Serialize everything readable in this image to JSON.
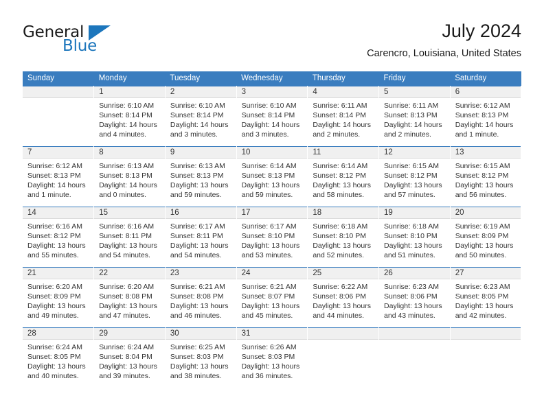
{
  "brand": {
    "name_part1": "General",
    "name_part2": "Blue",
    "accent_color": "#1c76bc"
  },
  "header": {
    "title": "July 2024",
    "subtitle": "Carencro, Louisiana, United States"
  },
  "theme": {
    "header_row_bg": "#3a7dbf",
    "daynum_band_bg": "#f0f0f0",
    "text_color": "#333333"
  },
  "weekday_headers": [
    "Sunday",
    "Monday",
    "Tuesday",
    "Wednesday",
    "Thursday",
    "Friday",
    "Saturday"
  ],
  "weeks": [
    [
      {
        "day": "",
        "sunrise": "",
        "sunset": "",
        "daylight": "",
        "empty": true
      },
      {
        "day": "1",
        "sunrise": "Sunrise: 6:10 AM",
        "sunset": "Sunset: 8:14 PM",
        "daylight": "Daylight: 14 hours and 4 minutes."
      },
      {
        "day": "2",
        "sunrise": "Sunrise: 6:10 AM",
        "sunset": "Sunset: 8:14 PM",
        "daylight": "Daylight: 14 hours and 3 minutes."
      },
      {
        "day": "3",
        "sunrise": "Sunrise: 6:10 AM",
        "sunset": "Sunset: 8:14 PM",
        "daylight": "Daylight: 14 hours and 3 minutes."
      },
      {
        "day": "4",
        "sunrise": "Sunrise: 6:11 AM",
        "sunset": "Sunset: 8:14 PM",
        "daylight": "Daylight: 14 hours and 2 minutes."
      },
      {
        "day": "5",
        "sunrise": "Sunrise: 6:11 AM",
        "sunset": "Sunset: 8:13 PM",
        "daylight": "Daylight: 14 hours and 2 minutes."
      },
      {
        "day": "6",
        "sunrise": "Sunrise: 6:12 AM",
        "sunset": "Sunset: 8:13 PM",
        "daylight": "Daylight: 14 hours and 1 minute."
      }
    ],
    [
      {
        "day": "7",
        "sunrise": "Sunrise: 6:12 AM",
        "sunset": "Sunset: 8:13 PM",
        "daylight": "Daylight: 14 hours and 1 minute."
      },
      {
        "day": "8",
        "sunrise": "Sunrise: 6:13 AM",
        "sunset": "Sunset: 8:13 PM",
        "daylight": "Daylight: 14 hours and 0 minutes."
      },
      {
        "day": "9",
        "sunrise": "Sunrise: 6:13 AM",
        "sunset": "Sunset: 8:13 PM",
        "daylight": "Daylight: 13 hours and 59 minutes."
      },
      {
        "day": "10",
        "sunrise": "Sunrise: 6:14 AM",
        "sunset": "Sunset: 8:13 PM",
        "daylight": "Daylight: 13 hours and 59 minutes."
      },
      {
        "day": "11",
        "sunrise": "Sunrise: 6:14 AM",
        "sunset": "Sunset: 8:12 PM",
        "daylight": "Daylight: 13 hours and 58 minutes."
      },
      {
        "day": "12",
        "sunrise": "Sunrise: 6:15 AM",
        "sunset": "Sunset: 8:12 PM",
        "daylight": "Daylight: 13 hours and 57 minutes."
      },
      {
        "day": "13",
        "sunrise": "Sunrise: 6:15 AM",
        "sunset": "Sunset: 8:12 PM",
        "daylight": "Daylight: 13 hours and 56 minutes."
      }
    ],
    [
      {
        "day": "14",
        "sunrise": "Sunrise: 6:16 AM",
        "sunset": "Sunset: 8:12 PM",
        "daylight": "Daylight: 13 hours and 55 minutes."
      },
      {
        "day": "15",
        "sunrise": "Sunrise: 6:16 AM",
        "sunset": "Sunset: 8:11 PM",
        "daylight": "Daylight: 13 hours and 54 minutes."
      },
      {
        "day": "16",
        "sunrise": "Sunrise: 6:17 AM",
        "sunset": "Sunset: 8:11 PM",
        "daylight": "Daylight: 13 hours and 54 minutes."
      },
      {
        "day": "17",
        "sunrise": "Sunrise: 6:17 AM",
        "sunset": "Sunset: 8:10 PM",
        "daylight": "Daylight: 13 hours and 53 minutes."
      },
      {
        "day": "18",
        "sunrise": "Sunrise: 6:18 AM",
        "sunset": "Sunset: 8:10 PM",
        "daylight": "Daylight: 13 hours and 52 minutes."
      },
      {
        "day": "19",
        "sunrise": "Sunrise: 6:18 AM",
        "sunset": "Sunset: 8:10 PM",
        "daylight": "Daylight: 13 hours and 51 minutes."
      },
      {
        "day": "20",
        "sunrise": "Sunrise: 6:19 AM",
        "sunset": "Sunset: 8:09 PM",
        "daylight": "Daylight: 13 hours and 50 minutes."
      }
    ],
    [
      {
        "day": "21",
        "sunrise": "Sunrise: 6:20 AM",
        "sunset": "Sunset: 8:09 PM",
        "daylight": "Daylight: 13 hours and 49 minutes."
      },
      {
        "day": "22",
        "sunrise": "Sunrise: 6:20 AM",
        "sunset": "Sunset: 8:08 PM",
        "daylight": "Daylight: 13 hours and 47 minutes."
      },
      {
        "day": "23",
        "sunrise": "Sunrise: 6:21 AM",
        "sunset": "Sunset: 8:08 PM",
        "daylight": "Daylight: 13 hours and 46 minutes."
      },
      {
        "day": "24",
        "sunrise": "Sunrise: 6:21 AM",
        "sunset": "Sunset: 8:07 PM",
        "daylight": "Daylight: 13 hours and 45 minutes."
      },
      {
        "day": "25",
        "sunrise": "Sunrise: 6:22 AM",
        "sunset": "Sunset: 8:06 PM",
        "daylight": "Daylight: 13 hours and 44 minutes."
      },
      {
        "day": "26",
        "sunrise": "Sunrise: 6:23 AM",
        "sunset": "Sunset: 8:06 PM",
        "daylight": "Daylight: 13 hours and 43 minutes."
      },
      {
        "day": "27",
        "sunrise": "Sunrise: 6:23 AM",
        "sunset": "Sunset: 8:05 PM",
        "daylight": "Daylight: 13 hours and 42 minutes."
      }
    ],
    [
      {
        "day": "28",
        "sunrise": "Sunrise: 6:24 AM",
        "sunset": "Sunset: 8:05 PM",
        "daylight": "Daylight: 13 hours and 40 minutes."
      },
      {
        "day": "29",
        "sunrise": "Sunrise: 6:24 AM",
        "sunset": "Sunset: 8:04 PM",
        "daylight": "Daylight: 13 hours and 39 minutes."
      },
      {
        "day": "30",
        "sunrise": "Sunrise: 6:25 AM",
        "sunset": "Sunset: 8:03 PM",
        "daylight": "Daylight: 13 hours and 38 minutes."
      },
      {
        "day": "31",
        "sunrise": "Sunrise: 6:26 AM",
        "sunset": "Sunset: 8:03 PM",
        "daylight": "Daylight: 13 hours and 36 minutes."
      },
      {
        "day": "",
        "sunrise": "",
        "sunset": "",
        "daylight": "",
        "empty": true
      },
      {
        "day": "",
        "sunrise": "",
        "sunset": "",
        "daylight": "",
        "empty": true
      },
      {
        "day": "",
        "sunrise": "",
        "sunset": "",
        "daylight": "",
        "empty": true
      }
    ]
  ]
}
